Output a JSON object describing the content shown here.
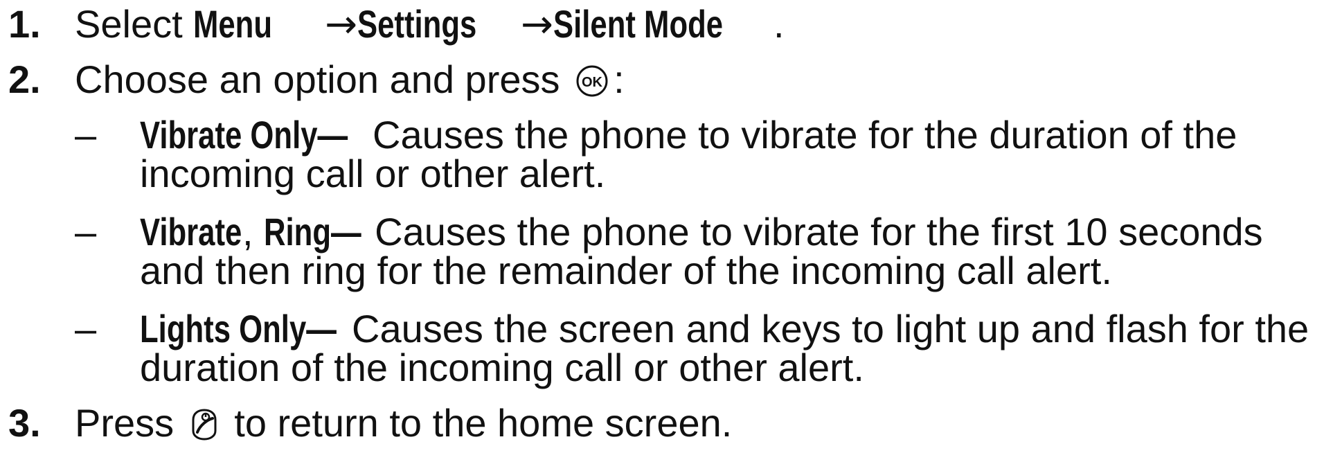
{
  "steps": [
    {
      "number": "1.",
      "prefix": "Select ",
      "path": [
        "Menu",
        "Settings",
        "Silent Mode"
      ],
      "arrow": "→",
      "suffix": "."
    },
    {
      "number": "2.",
      "text_before": "Choose an option and press ",
      "icon": "ok-key-icon",
      "text_after": ":",
      "options": [
        {
          "dash": "–",
          "term": "Vibrate Only—",
          "line1": "Causes the phone to vibrate for the duration of the",
          "line2": "incoming call or other alert."
        },
        {
          "dash": "–",
          "term_a": "Vibrate",
          "term_sep": ", ",
          "term_b": "Ring—",
          "line1": "Causes the phone to vibrate for the first 10 seconds",
          "line2": "and then ring for the remainder of the incoming call alert."
        },
        {
          "dash": "–",
          "term": "Lights Only—",
          "line1": "Causes the screen and keys to light up and flash for the",
          "line2": "duration of the incoming call or other alert."
        }
      ]
    },
    {
      "number": "3.",
      "text_before": "Press ",
      "icon": "end-key-icon",
      "text_after": " to return to the home screen."
    }
  ]
}
